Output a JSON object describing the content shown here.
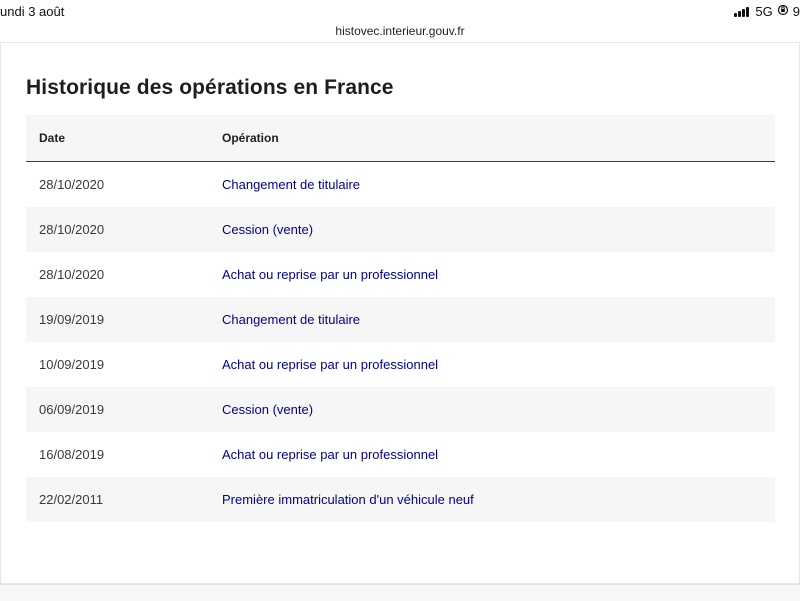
{
  "status_bar": {
    "date": "undi 3 août",
    "network": "5G",
    "battery_fragment": "9"
  },
  "browser": {
    "url": "histovec.interieur.gouv.fr"
  },
  "page": {
    "title": "Historique des opérations en France"
  },
  "table": {
    "headers": {
      "date": "Date",
      "operation": "Opération"
    },
    "rows": [
      {
        "date": "28/10/2020",
        "operation": "Changement de titulaire"
      },
      {
        "date": "28/10/2020",
        "operation": "Cession (vente)"
      },
      {
        "date": "28/10/2020",
        "operation": "Achat ou reprise par un professionnel"
      },
      {
        "date": "19/09/2019",
        "operation": "Changement de titulaire"
      },
      {
        "date": "10/09/2019",
        "operation": "Achat ou reprise par un professionnel"
      },
      {
        "date": "06/09/2019",
        "operation": "Cession (vente)"
      },
      {
        "date": "16/08/2019",
        "operation": "Achat ou reprise par un professionnel"
      },
      {
        "date": "22/02/2011",
        "operation": "Première immatriculation d'un véhicule neuf"
      }
    ]
  }
}
